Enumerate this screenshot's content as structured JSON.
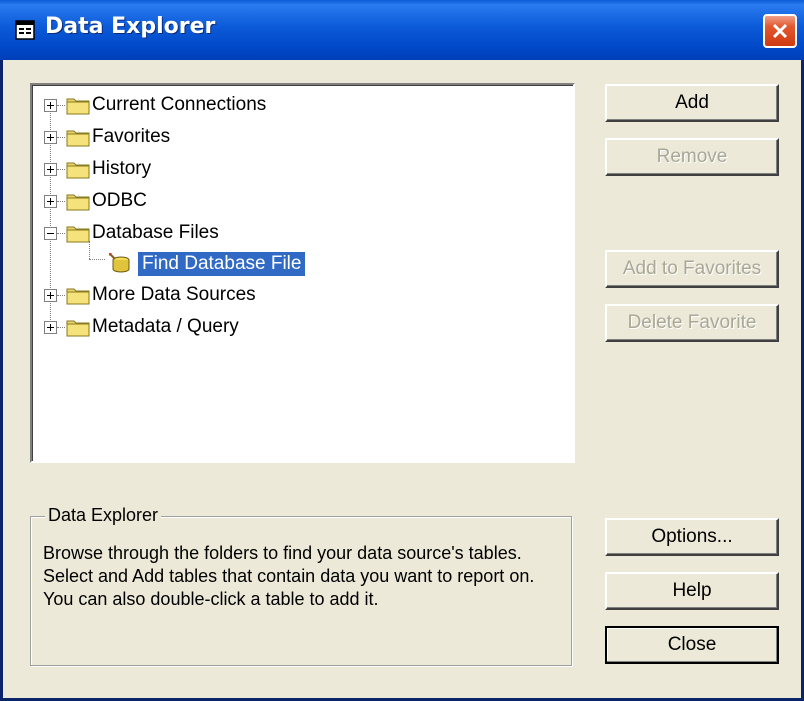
{
  "window": {
    "title": "Data Explorer",
    "icon": "data-explorer-app-icon"
  },
  "tree": {
    "nodes": [
      {
        "label": "Current Connections",
        "expander": "plus"
      },
      {
        "label": "Favorites",
        "expander": "plus"
      },
      {
        "label": "History",
        "expander": "plus"
      },
      {
        "label": "ODBC",
        "expander": "plus"
      },
      {
        "label": "Database Files",
        "expander": "minus"
      },
      {
        "label": "Find Database File",
        "selected": true,
        "child": true
      },
      {
        "label": "More Data Sources",
        "expander": "plus"
      },
      {
        "label": "Metadata / Query",
        "expander": "plus"
      }
    ]
  },
  "buttons": {
    "add": "Add",
    "remove": "Remove",
    "add_to_favorites": "Add to Favorites",
    "delete_favorite": "Delete Favorite",
    "options": "Options...",
    "help": "Help",
    "close": "Close"
  },
  "description": {
    "title": "Data Explorer",
    "text": "Browse through the folders to find your data source's tables.  Select and Add tables that contain data you want to report on.  You can also double-click a table to add it."
  },
  "colors": {
    "titlebar": "#0054e3",
    "dialog_bg": "#ece9d8",
    "selection": "#316ac5",
    "close_button": "#e0542a"
  }
}
